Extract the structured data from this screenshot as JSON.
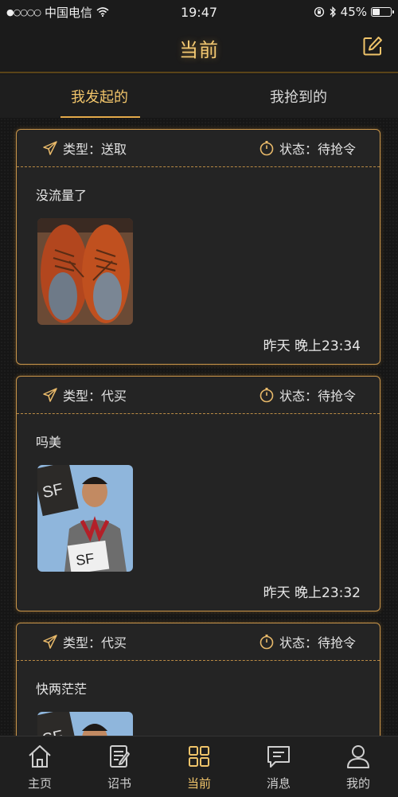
{
  "status_bar": {
    "carrier": "中国电信",
    "time": "19:47",
    "battery": "45%",
    "battery_level": 0.45
  },
  "header": {
    "title": "当前",
    "edit_icon": "edit-icon"
  },
  "tabs": [
    {
      "label": "我发起的",
      "active": true
    },
    {
      "label": "我抢到的",
      "active": false
    }
  ],
  "cards": [
    {
      "type_label": "类型：送取",
      "status_label": "状态：待抢令",
      "text": "没流量了",
      "image": "brown-shoes-photo",
      "time": "昨天 晚上23:34"
    },
    {
      "type_label": "类型：代买",
      "status_label": "状态：待抢令",
      "text": "吗美",
      "image": "courier-photo",
      "time": "昨天 晚上23:32"
    },
    {
      "type_label": "类型：代买",
      "status_label": "状态：待抢令",
      "text": "快两茫茫",
      "image": "courier-photo",
      "time": ""
    }
  ],
  "tab_bar": [
    {
      "label": "主页",
      "icon": "home-icon",
      "active": false
    },
    {
      "label": "诏书",
      "icon": "edict-icon",
      "active": false
    },
    {
      "label": "当前",
      "icon": "grid-icon",
      "active": true
    },
    {
      "label": "消息",
      "icon": "message-icon",
      "active": false
    },
    {
      "label": "我的",
      "icon": "user-icon",
      "active": false
    }
  ],
  "colors": {
    "accent": "#f0c46a",
    "border": "#c9954a",
    "background": "#1b1b1b"
  }
}
